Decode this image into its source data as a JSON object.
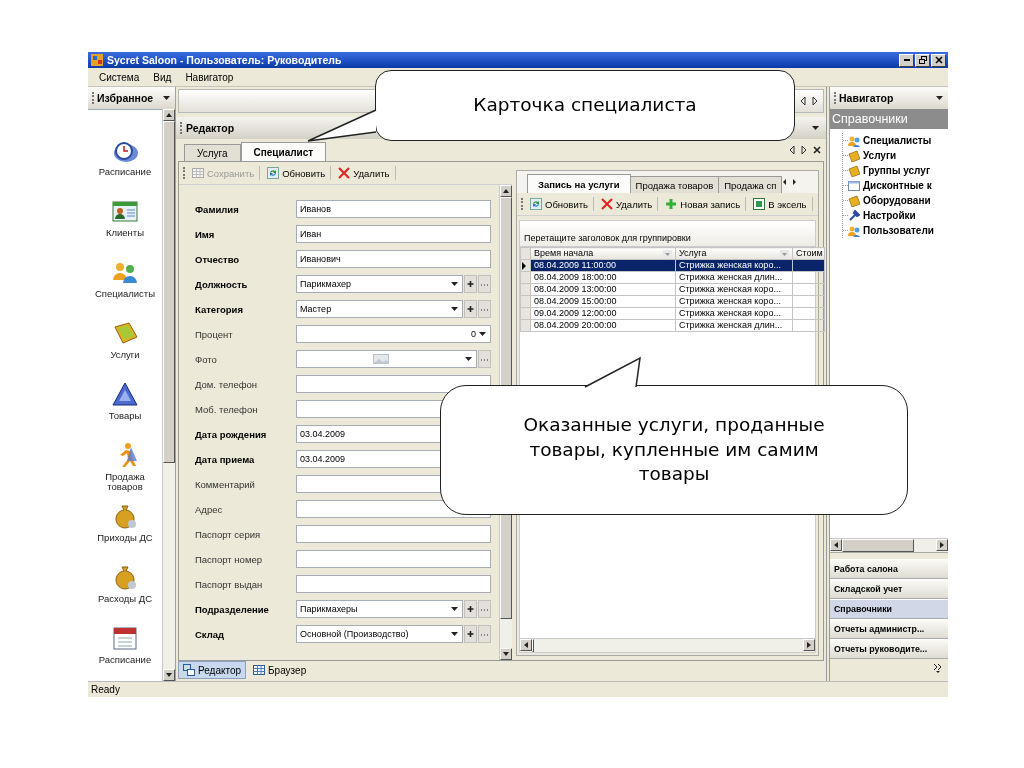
{
  "window": {
    "title": "Sycret Saloon - Пользователь: Руководитель"
  },
  "menu": [
    "Система",
    "Вид",
    "Навигатор"
  ],
  "favorites": {
    "title": "Избранное",
    "items": [
      "Расписание",
      "Клиенты",
      "Специалисты",
      "Услуги",
      "Товары",
      "Продажа товаров",
      "Приходы ДС",
      "Расходы ДС",
      "Расписание"
    ]
  },
  "editor": {
    "title": "Редактор",
    "tabs": [
      {
        "label": "Услуга",
        "selected": false
      },
      {
        "label": "Специалист",
        "selected": true
      }
    ],
    "toolbar": [
      {
        "label": "Сохранить",
        "kind": "save",
        "disabled": true
      },
      {
        "label": "Обновить",
        "kind": "refresh",
        "disabled": false
      },
      {
        "label": "Удалить",
        "kind": "delete",
        "disabled": false
      }
    ],
    "fields": [
      {
        "label": "Фамилия",
        "required": true,
        "kind": "text",
        "value": "Иванов"
      },
      {
        "label": "Имя",
        "required": true,
        "kind": "text",
        "value": "Иван"
      },
      {
        "label": "Отчество",
        "required": true,
        "kind": "text",
        "value": "Иванович"
      },
      {
        "label": "Должность",
        "required": true,
        "kind": "combo",
        "value": "Парикмахер"
      },
      {
        "label": "Категория",
        "required": true,
        "kind": "combo",
        "value": "Мастер"
      },
      {
        "label": "Процент",
        "required": false,
        "kind": "spin",
        "value": "0"
      },
      {
        "label": "Фото",
        "required": false,
        "kind": "image"
      },
      {
        "label": "Дом. телефон",
        "required": false,
        "kind": "text"
      },
      {
        "label": "Моб. телефон",
        "required": false,
        "kind": "text"
      },
      {
        "label": "Дата рождения",
        "required": true,
        "kind": "text",
        "value": "03.04.2009"
      },
      {
        "label": "Дата приема",
        "required": true,
        "kind": "text",
        "value": "03.04.2009"
      },
      {
        "label": "Комментарий",
        "required": false,
        "kind": "text"
      },
      {
        "label": "Адрес",
        "required": false,
        "kind": "text"
      },
      {
        "label": "Паспорт серия",
        "required": false,
        "kind": "text"
      },
      {
        "label": "Паспорт номер",
        "required": false,
        "kind": "text"
      },
      {
        "label": "Паспорт выдан",
        "required": false,
        "kind": "text"
      },
      {
        "label": "Подразделение",
        "required": true,
        "kind": "combo",
        "value": "Парикмахеры"
      },
      {
        "label": "Склад",
        "required": true,
        "kind": "combo",
        "value": "Основной (Производство)"
      }
    ]
  },
  "records": {
    "tabs": [
      {
        "label": "Запись на услуги",
        "selected": true
      },
      {
        "label": "Продажа товаров",
        "selected": false
      },
      {
        "label": "Продажа сп",
        "selected": false
      }
    ],
    "toolbar": [
      {
        "label": "Обновить",
        "kind": "refresh"
      },
      {
        "label": "Удалить",
        "kind": "delete"
      },
      {
        "label": "Новая запись",
        "kind": "add"
      },
      {
        "label": "В эксель",
        "kind": "excel"
      }
    ],
    "group_hint": "Перетащите заголовок для группировки",
    "columns": [
      "Время начала",
      "Услуга",
      "Стоим"
    ],
    "rows": [
      {
        "start": "08.04.2009 11:00:00",
        "service": "Стрижка женская коро...",
        "selected": true
      },
      {
        "start": "08.04.2009 18:00:00",
        "service": "Стрижка женская длин...",
        "selected": false
      },
      {
        "start": "08.04.2009 13:00:00",
        "service": "Стрижка женская коро...",
        "selected": false
      },
      {
        "start": "08.04.2009 15:00:00",
        "service": "Стрижка женская коро...",
        "selected": false
      },
      {
        "start": "09.04.2009 12:00:00",
        "service": "Стрижка женская коро...",
        "selected": false
      },
      {
        "start": "08.04.2009 20:00:00",
        "service": "Стрижка женская длин...",
        "selected": false
      }
    ]
  },
  "bottom_tabs": [
    {
      "label": "Редактор",
      "selected": true
    },
    {
      "label": "Браузер",
      "selected": false
    }
  ],
  "navigator": {
    "title": "Навигатор",
    "section": "Справочники",
    "tree": [
      "Специалисты",
      "Услуги",
      "Группы услуг",
      "Дисконтные к",
      "Оборудовани",
      "Настройки",
      "Пользователи"
    ],
    "groups": [
      {
        "label": "Работа салона",
        "selected": false
      },
      {
        "label": "Складской учет",
        "selected": false
      },
      {
        "label": "Справочники",
        "selected": true
      },
      {
        "label": "Отчеты администр...",
        "selected": false
      },
      {
        "label": "Отчеты руководите...",
        "selected": false
      }
    ]
  },
  "status_bar": "Ready",
  "callouts": [
    "Карточка специалиста",
    "Оказанные услуги, проданные товары, купленные им самим товары"
  ]
}
